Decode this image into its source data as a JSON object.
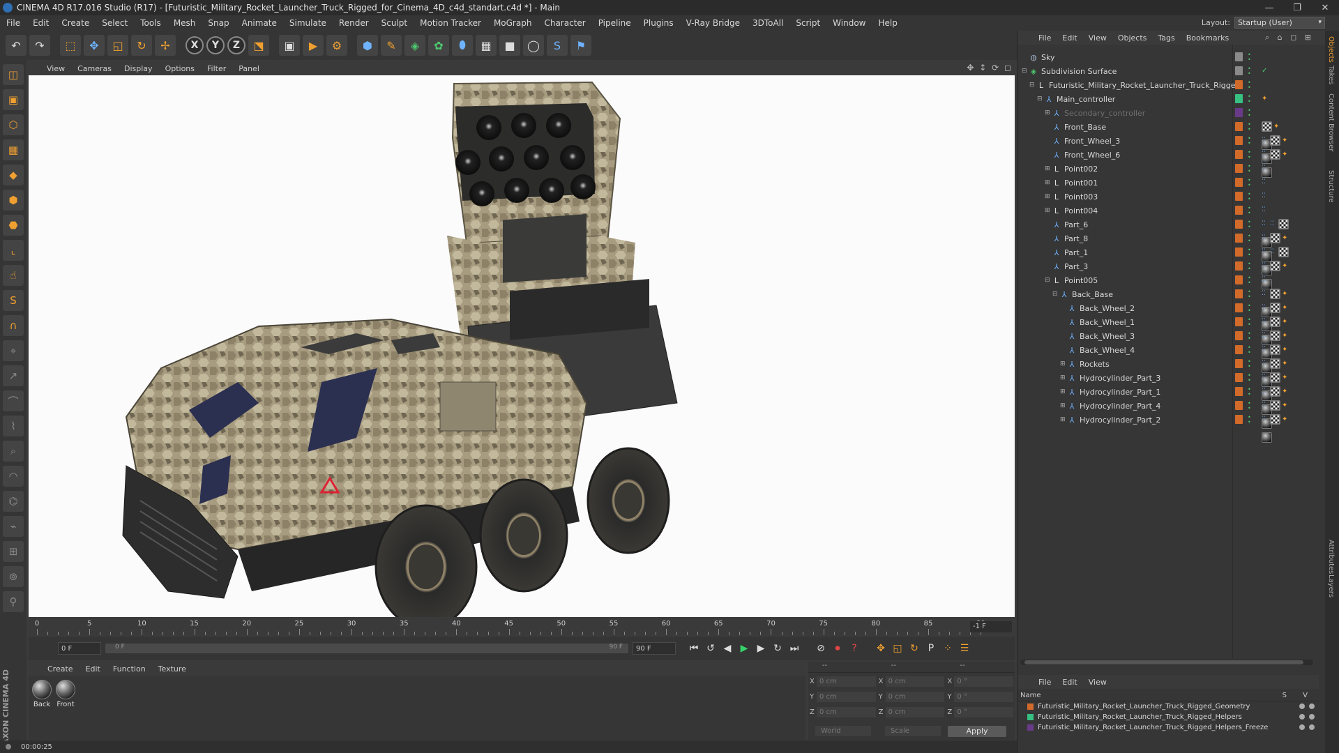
{
  "window": {
    "title": "CINEMA 4D R17.016 Studio (R17) - [Futuristic_Military_Rocket_Launcher_Truck_Rigged_for_Cinema_4D_c4d_standart.c4d *] - Main",
    "min": "—",
    "max": "❐",
    "close": "✕"
  },
  "menu": [
    "File",
    "Edit",
    "Create",
    "Select",
    "Tools",
    "Mesh",
    "Snap",
    "Animate",
    "Simulate",
    "Render",
    "Sculpt",
    "Motion Tracker",
    "MoGraph",
    "Character",
    "Pipeline",
    "Plugins",
    "V-Ray Bridge",
    "3DToAll",
    "Script",
    "Window",
    "Help"
  ],
  "layout": {
    "label": "Layout:",
    "value": "Startup (User)",
    "chevron": "▾"
  },
  "toolbar": {
    "undo": "↶",
    "redo": "↷",
    "select": "⬚",
    "move": "✥",
    "scale": "◱",
    "rotate": "↻",
    "transform": "✢",
    "x": "X",
    "y": "Y",
    "z": "Z",
    "coord_sys": "⬔",
    "render_view": "▣",
    "render_pv": "▶",
    "render_settings": "⚙",
    "cube": "⬢",
    "pen": "✎",
    "subdiv": "◈",
    "mograph": "✿",
    "deformer": "⬮",
    "floor": "▦",
    "camera": "■",
    "light": "◯",
    "python": "S",
    "script": "⚑"
  },
  "left_tools": [
    "◫",
    "▣",
    "⬡",
    "▦",
    "◆",
    "⬢",
    "⬣",
    "⌞",
    "☝",
    "S",
    "∩",
    "⌖",
    "↗",
    "⌒",
    "⌇",
    "⌕",
    "◠",
    "⌬",
    "⌁",
    "⊞",
    "⊚",
    "⚲"
  ],
  "maxon_logo": "MAXON CINEMA 4D",
  "viewport": {
    "menu": [
      "View",
      "Cameras",
      "Display",
      "Options",
      "Filter",
      "Panel"
    ],
    "nav": "✥ ↕ ⟳ ◻"
  },
  "timeline": {
    "ticks": [
      "0",
      "5",
      "10",
      "15",
      "20",
      "25",
      "30",
      "35",
      "40",
      "45",
      "50",
      "55",
      "60",
      "65",
      "70",
      "75",
      "80",
      "85",
      "90"
    ],
    "end_field": "-1 F"
  },
  "transport": {
    "current_frame": "0 F",
    "range_start": "0 F",
    "range_end": "90 F",
    "max_frame": "90 F",
    "buttons": {
      "first": "⏮",
      "prev_key": "↺",
      "prev": "◀",
      "play": "▶",
      "next": "▶",
      "next_key": "↻",
      "last": "⏭",
      "motion": "⊘",
      "record": "⏺",
      "auto": "?",
      "key_move": "✥",
      "key_scale": "◱",
      "key_rot": "↻",
      "key_param": "P",
      "key_pla": "⁘",
      "timeline": "☰"
    }
  },
  "materials": {
    "menu": [
      "Create",
      "Edit",
      "Function",
      "Texture"
    ],
    "items": [
      {
        "label": "Back"
      },
      {
        "label": "Front"
      }
    ]
  },
  "coords": {
    "headers": [
      "--",
      "--",
      "--"
    ],
    "rows": [
      {
        "a": "X",
        "pos": "0 cm",
        "b": "X",
        "size": "0 cm",
        "c": "X",
        "rot": "0 °"
      },
      {
        "a": "Y",
        "pos": "0 cm",
        "b": "Y",
        "size": "0 cm",
        "c": "Y",
        "rot": "0 °"
      },
      {
        "a": "Z",
        "pos": "0 cm",
        "b": "Z",
        "size": "0 cm",
        "c": "Z",
        "rot": "0 °"
      }
    ],
    "world": "World",
    "scale": "Scale",
    "apply": "Apply"
  },
  "status": {
    "time": "00:00:25"
  },
  "objects": {
    "menu": [
      "File",
      "Edit",
      "View",
      "Objects",
      "Tags",
      "Bookmarks"
    ],
    "tools": "⌕ ⌂ ◻ ⊞",
    "tree": [
      {
        "name": "Sky",
        "icon": "sky",
        "depth": 0,
        "expand": "",
        "color": "gray",
        "tags": []
      },
      {
        "name": "Subdivision Surface",
        "icon": "subd",
        "depth": 0,
        "expand": "⊟",
        "color": "gray",
        "tags": [
          "check"
        ]
      },
      {
        "name": "Futuristic_Military_Rocket_Launcher_Truck_Rigged",
        "icon": "null",
        "depth": 1,
        "expand": "⊟",
        "color": "orange",
        "tags": []
      },
      {
        "name": "Main_controller",
        "icon": "joint",
        "depth": 2,
        "expand": "⊟",
        "color": "green",
        "tags": [
          "ik"
        ]
      },
      {
        "name": "Secondary_controller",
        "icon": "joint",
        "depth": 3,
        "expand": "⊞",
        "color": "purple",
        "tags": [],
        "disabled": true
      },
      {
        "name": "Front_Base",
        "icon": "joint",
        "depth": 3,
        "expand": "",
        "color": "orange",
        "tags": [
          "mat",
          "chk",
          "ik"
        ]
      },
      {
        "name": "Front_Wheel_3",
        "icon": "joint",
        "depth": 3,
        "expand": "",
        "color": "orange",
        "tags": [
          "dots",
          "mat",
          "chk",
          "ik"
        ]
      },
      {
        "name": "Front_Wheel_6",
        "icon": "joint",
        "depth": 3,
        "expand": "",
        "color": "orange",
        "tags": [
          "dots",
          "mat",
          "chk",
          "ik"
        ]
      },
      {
        "name": "Point002",
        "icon": "null",
        "depth": 3,
        "expand": "⊞",
        "color": "orange",
        "tags": [
          "dots"
        ]
      },
      {
        "name": "Point001",
        "icon": "null",
        "depth": 3,
        "expand": "⊞",
        "color": "orange",
        "tags": [
          "dots"
        ]
      },
      {
        "name": "Point003",
        "icon": "null",
        "depth": 3,
        "expand": "⊞",
        "color": "orange",
        "tags": [
          "dots"
        ]
      },
      {
        "name": "Point004",
        "icon": "null",
        "depth": 3,
        "expand": "⊞",
        "color": "orange",
        "tags": [
          "dots"
        ]
      },
      {
        "name": "Part_6",
        "icon": "joint",
        "depth": 3,
        "expand": "",
        "color": "orange",
        "tags": [
          "dots",
          "dots",
          "mat",
          "chk"
        ]
      },
      {
        "name": "Part_8",
        "icon": "joint",
        "depth": 3,
        "expand": "",
        "color": "orange",
        "tags": [
          "dots",
          "mat",
          "chk",
          "ik"
        ]
      },
      {
        "name": "Part_1",
        "icon": "joint",
        "depth": 3,
        "expand": "",
        "color": "orange",
        "tags": [
          "dots",
          "dots",
          "mat",
          "chk"
        ]
      },
      {
        "name": "Part_3",
        "icon": "joint",
        "depth": 3,
        "expand": "",
        "color": "orange",
        "tags": [
          "dots",
          "mat",
          "chk",
          "ik"
        ]
      },
      {
        "name": "Point005",
        "icon": "null",
        "depth": 3,
        "expand": "⊟",
        "color": "orange",
        "tags": [
          "dots"
        ]
      },
      {
        "name": "Back_Base",
        "icon": "joint",
        "depth": 4,
        "expand": "⊟",
        "color": "orange",
        "tags": [
          "dots",
          "mat",
          "chk",
          "ik"
        ]
      },
      {
        "name": "Back_Wheel_2",
        "icon": "joint",
        "depth": 5,
        "expand": "",
        "color": "orange",
        "tags": [
          "dots",
          "mat",
          "chk",
          "ik"
        ]
      },
      {
        "name": "Back_Wheel_1",
        "icon": "joint",
        "depth": 5,
        "expand": "",
        "color": "orange",
        "tags": [
          "dots",
          "mat",
          "chk",
          "ik"
        ]
      },
      {
        "name": "Back_Wheel_3",
        "icon": "joint",
        "depth": 5,
        "expand": "",
        "color": "orange",
        "tags": [
          "dots",
          "mat",
          "chk",
          "ik"
        ]
      },
      {
        "name": "Back_Wheel_4",
        "icon": "joint",
        "depth": 5,
        "expand": "",
        "color": "orange",
        "tags": [
          "dots",
          "mat",
          "chk",
          "ik"
        ]
      },
      {
        "name": "Rockets",
        "icon": "joint",
        "depth": 5,
        "expand": "⊞",
        "color": "orange",
        "tags": [
          "dots",
          "mat",
          "chk",
          "ik"
        ]
      },
      {
        "name": "Hydrocylinder_Part_3",
        "icon": "joint",
        "depth": 5,
        "expand": "⊞",
        "color": "orange",
        "tags": [
          "dots",
          "mat",
          "chk",
          "ik"
        ]
      },
      {
        "name": "Hydrocylinder_Part_1",
        "icon": "joint",
        "depth": 5,
        "expand": "⊞",
        "color": "orange",
        "tags": [
          "dots",
          "mat",
          "chk",
          "ik"
        ]
      },
      {
        "name": "Hydrocylinder_Part_4",
        "icon": "joint",
        "depth": 5,
        "expand": "⊞",
        "color": "orange",
        "tags": [
          "dots",
          "mat",
          "chk",
          "ik"
        ]
      },
      {
        "name": "Hydrocylinder_Part_2",
        "icon": "joint",
        "depth": 5,
        "expand": "⊞",
        "color": "orange",
        "tags": [
          "dots",
          "mat",
          "chk",
          "ik"
        ]
      }
    ]
  },
  "layers": {
    "menu": [
      "File",
      "Edit",
      "View"
    ],
    "header": "Name",
    "sv": "S V",
    "rows": [
      {
        "name": "Futuristic_Military_Rocket_Launcher_Truck_Rigged_Geometry",
        "color": "#d26a2a"
      },
      {
        "name": "Futuristic_Military_Rocket_Launcher_Truck_Rigged_Helpers",
        "color": "#36c081"
      },
      {
        "name": "Futuristic_Military_Rocket_Launcher_Truck_Rigged_Helpers_Freeze",
        "color": "#6a3a8a"
      }
    ]
  },
  "side_tabs": [
    "Objects",
    "Takes",
    "Content Browser",
    "Structure",
    "Attributes",
    "Layers"
  ]
}
